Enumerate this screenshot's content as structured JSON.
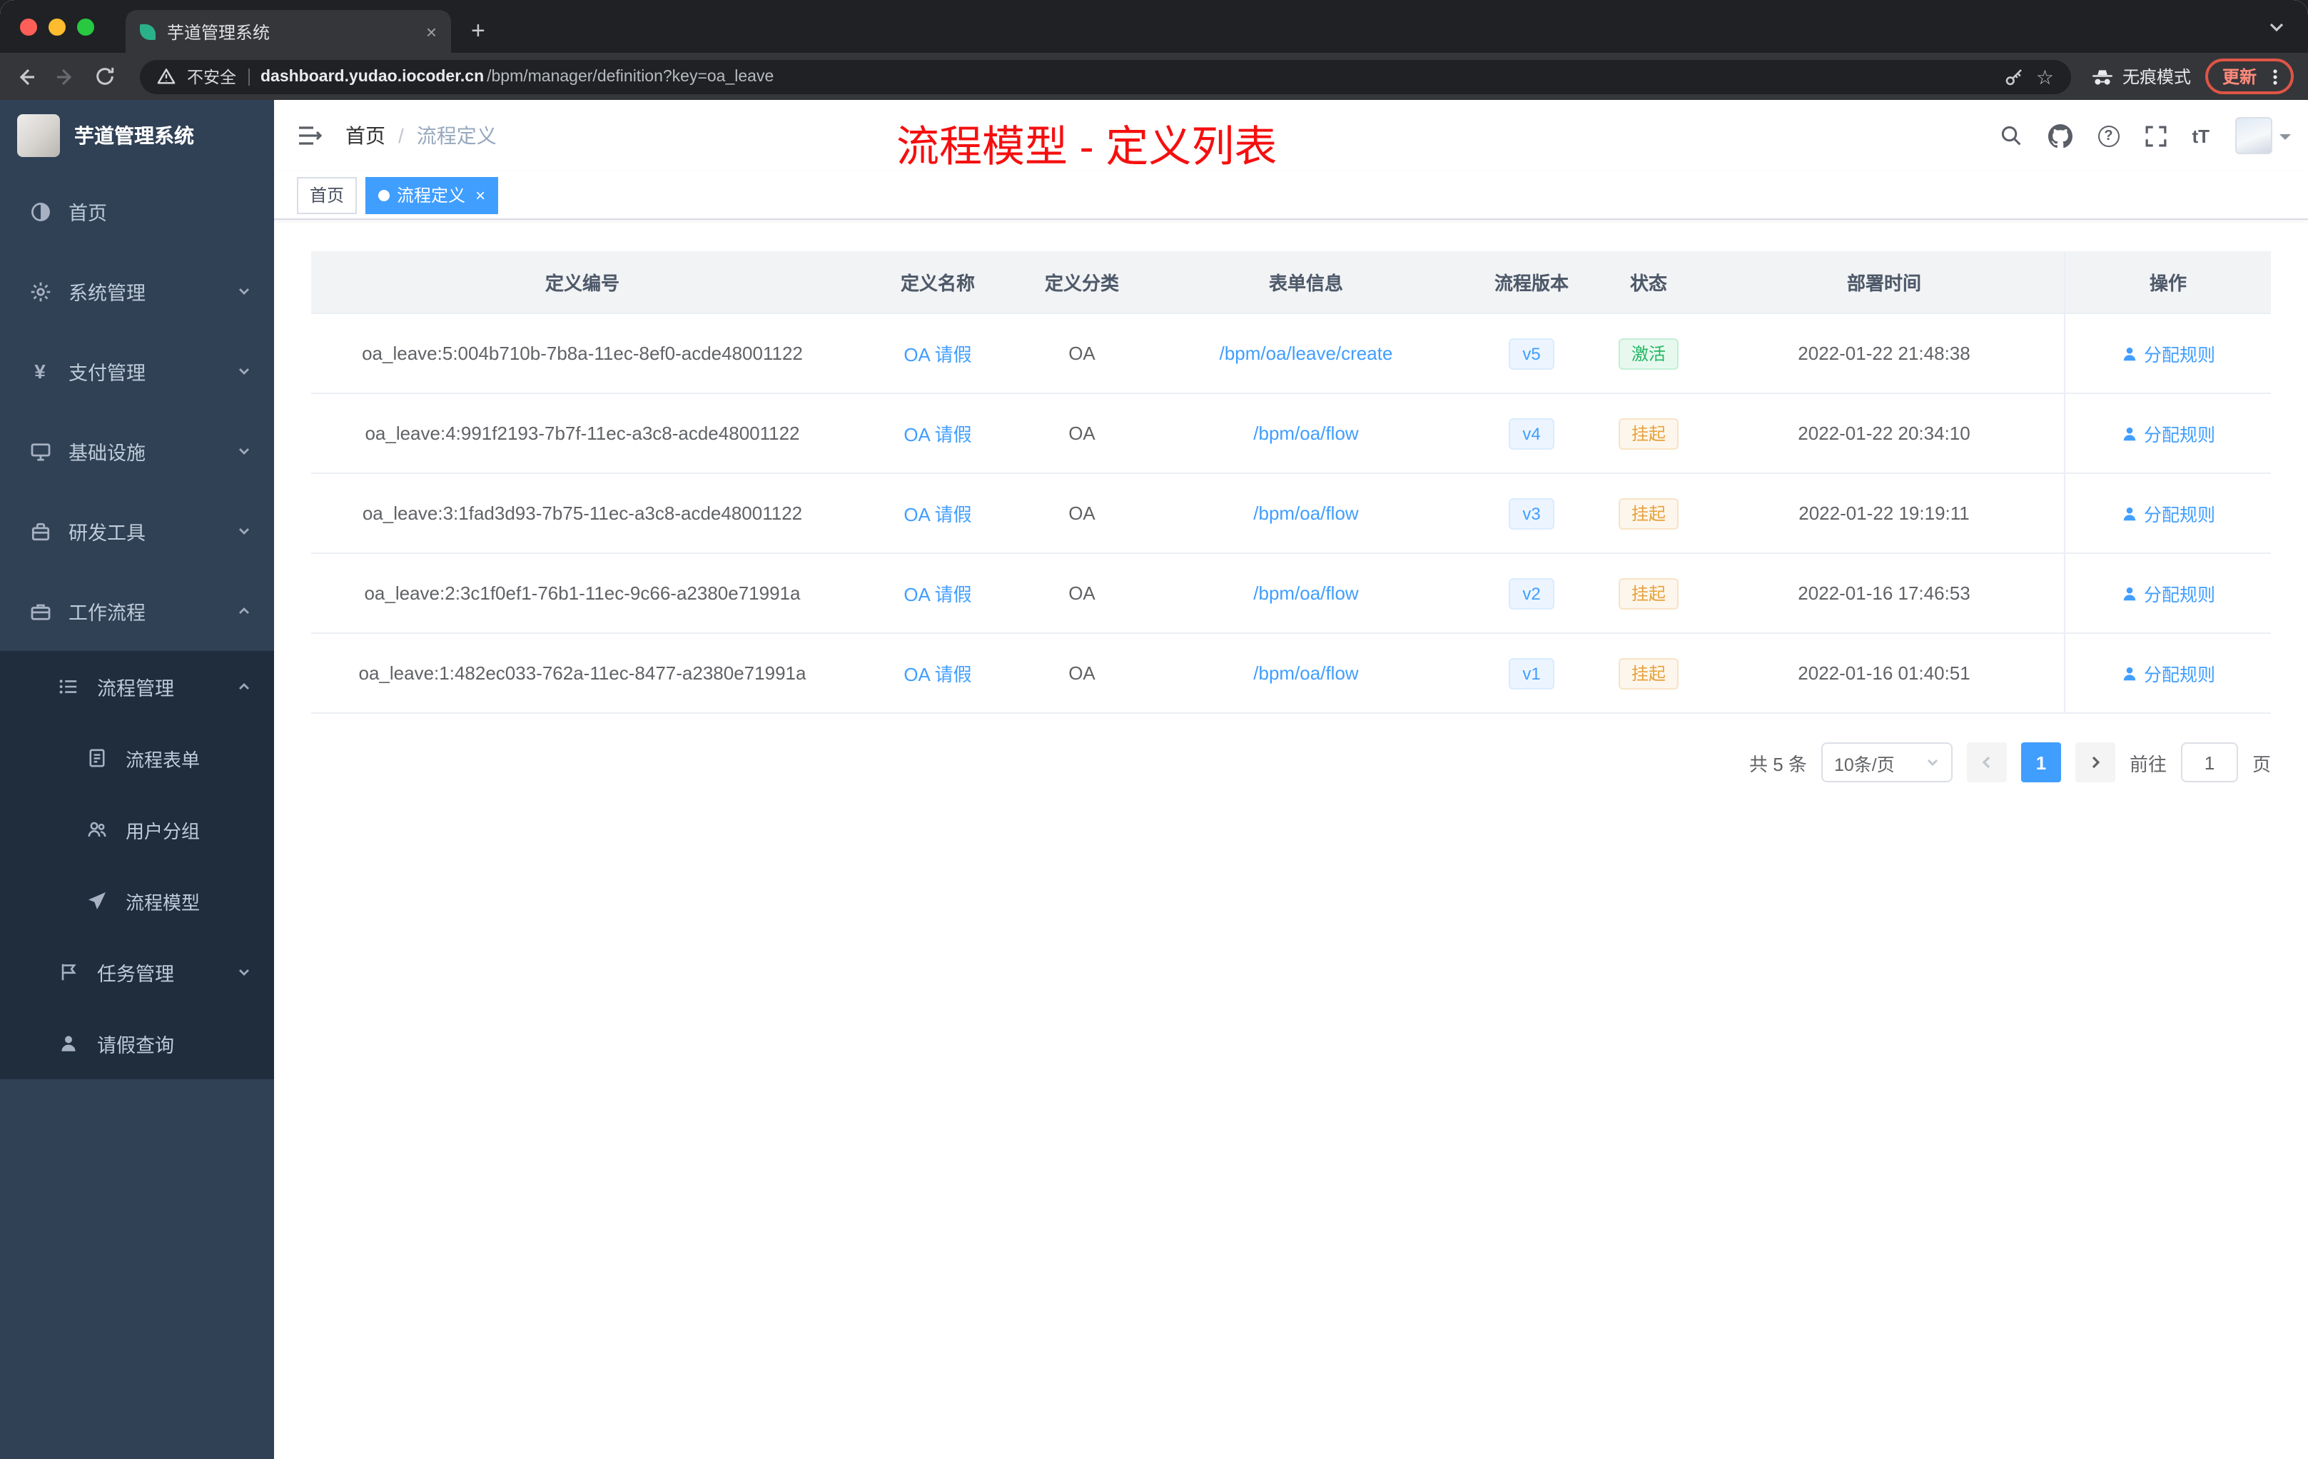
{
  "browser": {
    "tab": {
      "title": "芋道管理系统",
      "close": "×",
      "new_tab": "+"
    },
    "address": {
      "security_label": "不安全",
      "url_domain": "dashboard.yudao.iocoder.cn",
      "url_path": "/bpm/manager/definition?key=oa_leave",
      "incognito_label": "无痕模式",
      "update_label": "更新"
    }
  },
  "icons": {
    "star": "☆",
    "help": "?",
    "font_size": "tT",
    "payment": "¥"
  },
  "sidebar": {
    "title": "芋道管理系统",
    "items": [
      {
        "label": "首页"
      },
      {
        "label": "系统管理"
      },
      {
        "label": "支付管理"
      },
      {
        "label": "基础设施"
      },
      {
        "label": "研发工具"
      },
      {
        "label": "工作流程"
      },
      {
        "label": "流程管理"
      },
      {
        "label": "流程表单"
      },
      {
        "label": "用户分组"
      },
      {
        "label": "流程模型"
      },
      {
        "label": "任务管理"
      },
      {
        "label": "请假查询"
      }
    ]
  },
  "header": {
    "breadcrumb": {
      "home": "首页",
      "separator": "/",
      "current": "流程定义"
    },
    "annotation": "流程模型 - 定义列表"
  },
  "tags": [
    {
      "label": "首页"
    },
    {
      "label": "流程定义",
      "close": "×"
    }
  ],
  "table": {
    "columns": [
      "定义编号",
      "定义名称",
      "定义分类",
      "表单信息",
      "流程版本",
      "状态",
      "部署时间",
      "操作"
    ],
    "rows": [
      {
        "id": "oa_leave:5:004b710b-7b8a-11ec-8ef0-acde48001122",
        "name": "OA 请假",
        "category": "OA",
        "form": "/bpm/oa/leave/create",
        "version": "v5",
        "status": "激活",
        "status_type": "success",
        "deploy_time": "2022-01-22 21:48:38",
        "action": "分配规则"
      },
      {
        "id": "oa_leave:4:991f2193-7b7f-11ec-a3c8-acde48001122",
        "name": "OA 请假",
        "category": "OA",
        "form": "/bpm/oa/flow",
        "version": "v4",
        "status": "挂起",
        "status_type": "warning",
        "deploy_time": "2022-01-22 20:34:10",
        "action": "分配规则"
      },
      {
        "id": "oa_leave:3:1fad3d93-7b75-11ec-a3c8-acde48001122",
        "name": "OA 请假",
        "category": "OA",
        "form": "/bpm/oa/flow",
        "version": "v3",
        "status": "挂起",
        "status_type": "warning",
        "deploy_time": "2022-01-22 19:19:11",
        "action": "分配规则"
      },
      {
        "id": "oa_leave:2:3c1f0ef1-76b1-11ec-9c66-a2380e71991a",
        "name": "OA 请假",
        "category": "OA",
        "form": "/bpm/oa/flow",
        "version": "v2",
        "status": "挂起",
        "status_type": "warning",
        "deploy_time": "2022-01-16 17:46:53",
        "action": "分配规则"
      },
      {
        "id": "oa_leave:1:482ec033-762a-11ec-8477-a2380e71991a",
        "name": "OA 请假",
        "category": "OA",
        "form": "/bpm/oa/flow",
        "version": "v1",
        "status": "挂起",
        "status_type": "warning",
        "deploy_time": "2022-01-16 01:40:51",
        "action": "分配规则"
      }
    ]
  },
  "pagination": {
    "total": "共 5 条",
    "page_size": "10条/页",
    "current_page": "1",
    "goto_label": "前往",
    "goto_value": "1",
    "goto_unit": "页"
  }
}
